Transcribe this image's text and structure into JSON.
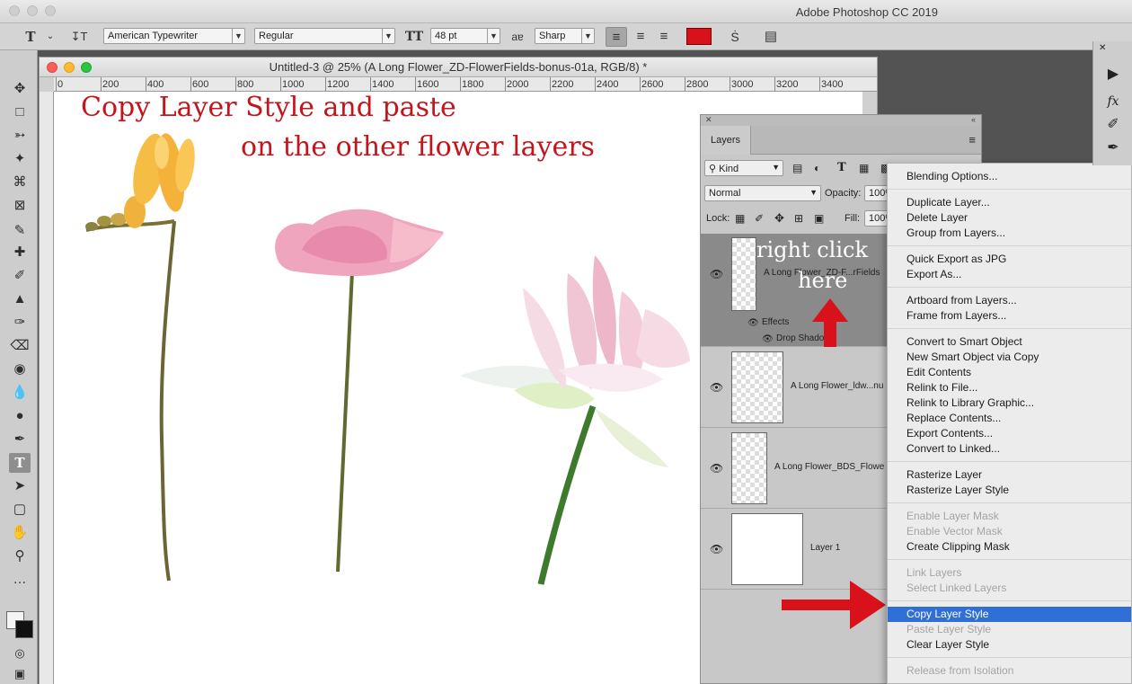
{
  "app": {
    "title": "Adobe Photoshop CC 2019"
  },
  "options": {
    "font_family": "American Typewriter",
    "font_style": "Regular",
    "font_size": "48 pt",
    "antialias_label": "aɐ",
    "antialias": "Sharp",
    "text_color": "#d9111a"
  },
  "document": {
    "title": "Untitled-3 @ 25% (A Long Flower_ZD-FlowerFields-bonus-01a, RGB/8) *",
    "ruler_ticks": [
      "0",
      "200",
      "400",
      "600",
      "800",
      "1000",
      "1200",
      "1400",
      "1600",
      "1800",
      "2000",
      "2200",
      "2400",
      "2600",
      "2800",
      "3000",
      "3200",
      "3400"
    ],
    "headline_1": "Copy Layer Style and paste",
    "headline_2": "on the other flower layers"
  },
  "layers_panel": {
    "tab": "Layers",
    "filter_kind": "Kind",
    "blend_mode": "Normal",
    "opacity_label": "Opacity:",
    "opacity_value": "100%",
    "lock_label": "Lock:",
    "fill_label": "Fill:",
    "fill_value": "100%",
    "layers": [
      {
        "name": "A Long Flower_ZD-F...rFields",
        "selected": true
      },
      {
        "name": "A Long Flower_ldw...nu",
        "selected": false
      },
      {
        "name": "A Long Flower_BDS_Flowe",
        "selected": false
      },
      {
        "name": "Layer 1",
        "selected": false
      }
    ],
    "effects_label": "Effects",
    "drop_shadow_label": "Drop Shadow",
    "annotation_line1": "right click",
    "annotation_line2": "here"
  },
  "context_menu": {
    "items": [
      {
        "label": "Blending Options...",
        "disabled": false
      },
      {
        "label": "Duplicate Layer...",
        "disabled": false
      },
      {
        "label": "Delete Layer",
        "disabled": false
      },
      {
        "label": "Group from Layers...",
        "disabled": false
      },
      {
        "label": "Quick Export as JPG",
        "disabled": false
      },
      {
        "label": "Export As...",
        "disabled": false
      },
      {
        "label": "Artboard from Layers...",
        "disabled": false
      },
      {
        "label": "Frame from Layers...",
        "disabled": false
      },
      {
        "label": "Convert to Smart Object",
        "disabled": false
      },
      {
        "label": "New Smart Object via Copy",
        "disabled": false
      },
      {
        "label": "Edit Contents",
        "disabled": false
      },
      {
        "label": "Relink to File...",
        "disabled": false
      },
      {
        "label": "Relink to Library Graphic...",
        "disabled": false
      },
      {
        "label": "Replace Contents...",
        "disabled": false
      },
      {
        "label": "Export Contents...",
        "disabled": false
      },
      {
        "label": "Convert to Linked...",
        "disabled": false
      },
      {
        "label": "Rasterize Layer",
        "disabled": false
      },
      {
        "label": "Rasterize Layer Style",
        "disabled": false
      },
      {
        "label": "Enable Layer Mask",
        "disabled": true
      },
      {
        "label": "Enable Vector Mask",
        "disabled": true
      },
      {
        "label": "Create Clipping Mask",
        "disabled": false
      },
      {
        "label": "Link Layers",
        "disabled": true
      },
      {
        "label": "Select Linked Layers",
        "disabled": true
      },
      {
        "label": "Copy Layer Style",
        "disabled": false,
        "highlighted": true
      },
      {
        "label": "Paste Layer Style",
        "disabled": true
      },
      {
        "label": "Clear Layer Style",
        "disabled": false
      },
      {
        "label": "Release from Isolation",
        "disabled": true
      }
    ]
  },
  "colors": {
    "accent_red": "#d9111a",
    "menu_highlight": "#2f6fd6"
  }
}
